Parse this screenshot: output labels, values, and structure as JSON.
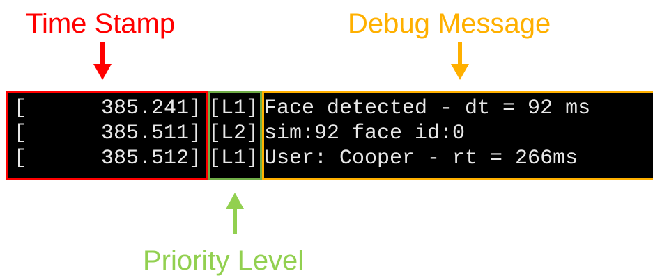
{
  "labels": {
    "time_stamp": "Time Stamp",
    "debug_message": "Debug Message",
    "priority_level": "Priority Level"
  },
  "colors": {
    "time_stamp": "#ff0000",
    "debug_message": "#ffb000",
    "priority_level": "#92d050",
    "terminal_bg": "#000000",
    "terminal_text": "#e8e8e8"
  },
  "log_lines": [
    {
      "open": "[",
      "timestamp": "385.241]",
      "priority": "[L1]",
      "message": "Face detected - dt = 92 ms"
    },
    {
      "open": "[",
      "timestamp": "385.511]",
      "priority": "[L2]",
      "message": "sim:92 face id:0"
    },
    {
      "open": "[",
      "timestamp": "385.512]",
      "priority": "[L1]",
      "message": "User: Cooper - rt = 266ms"
    }
  ]
}
